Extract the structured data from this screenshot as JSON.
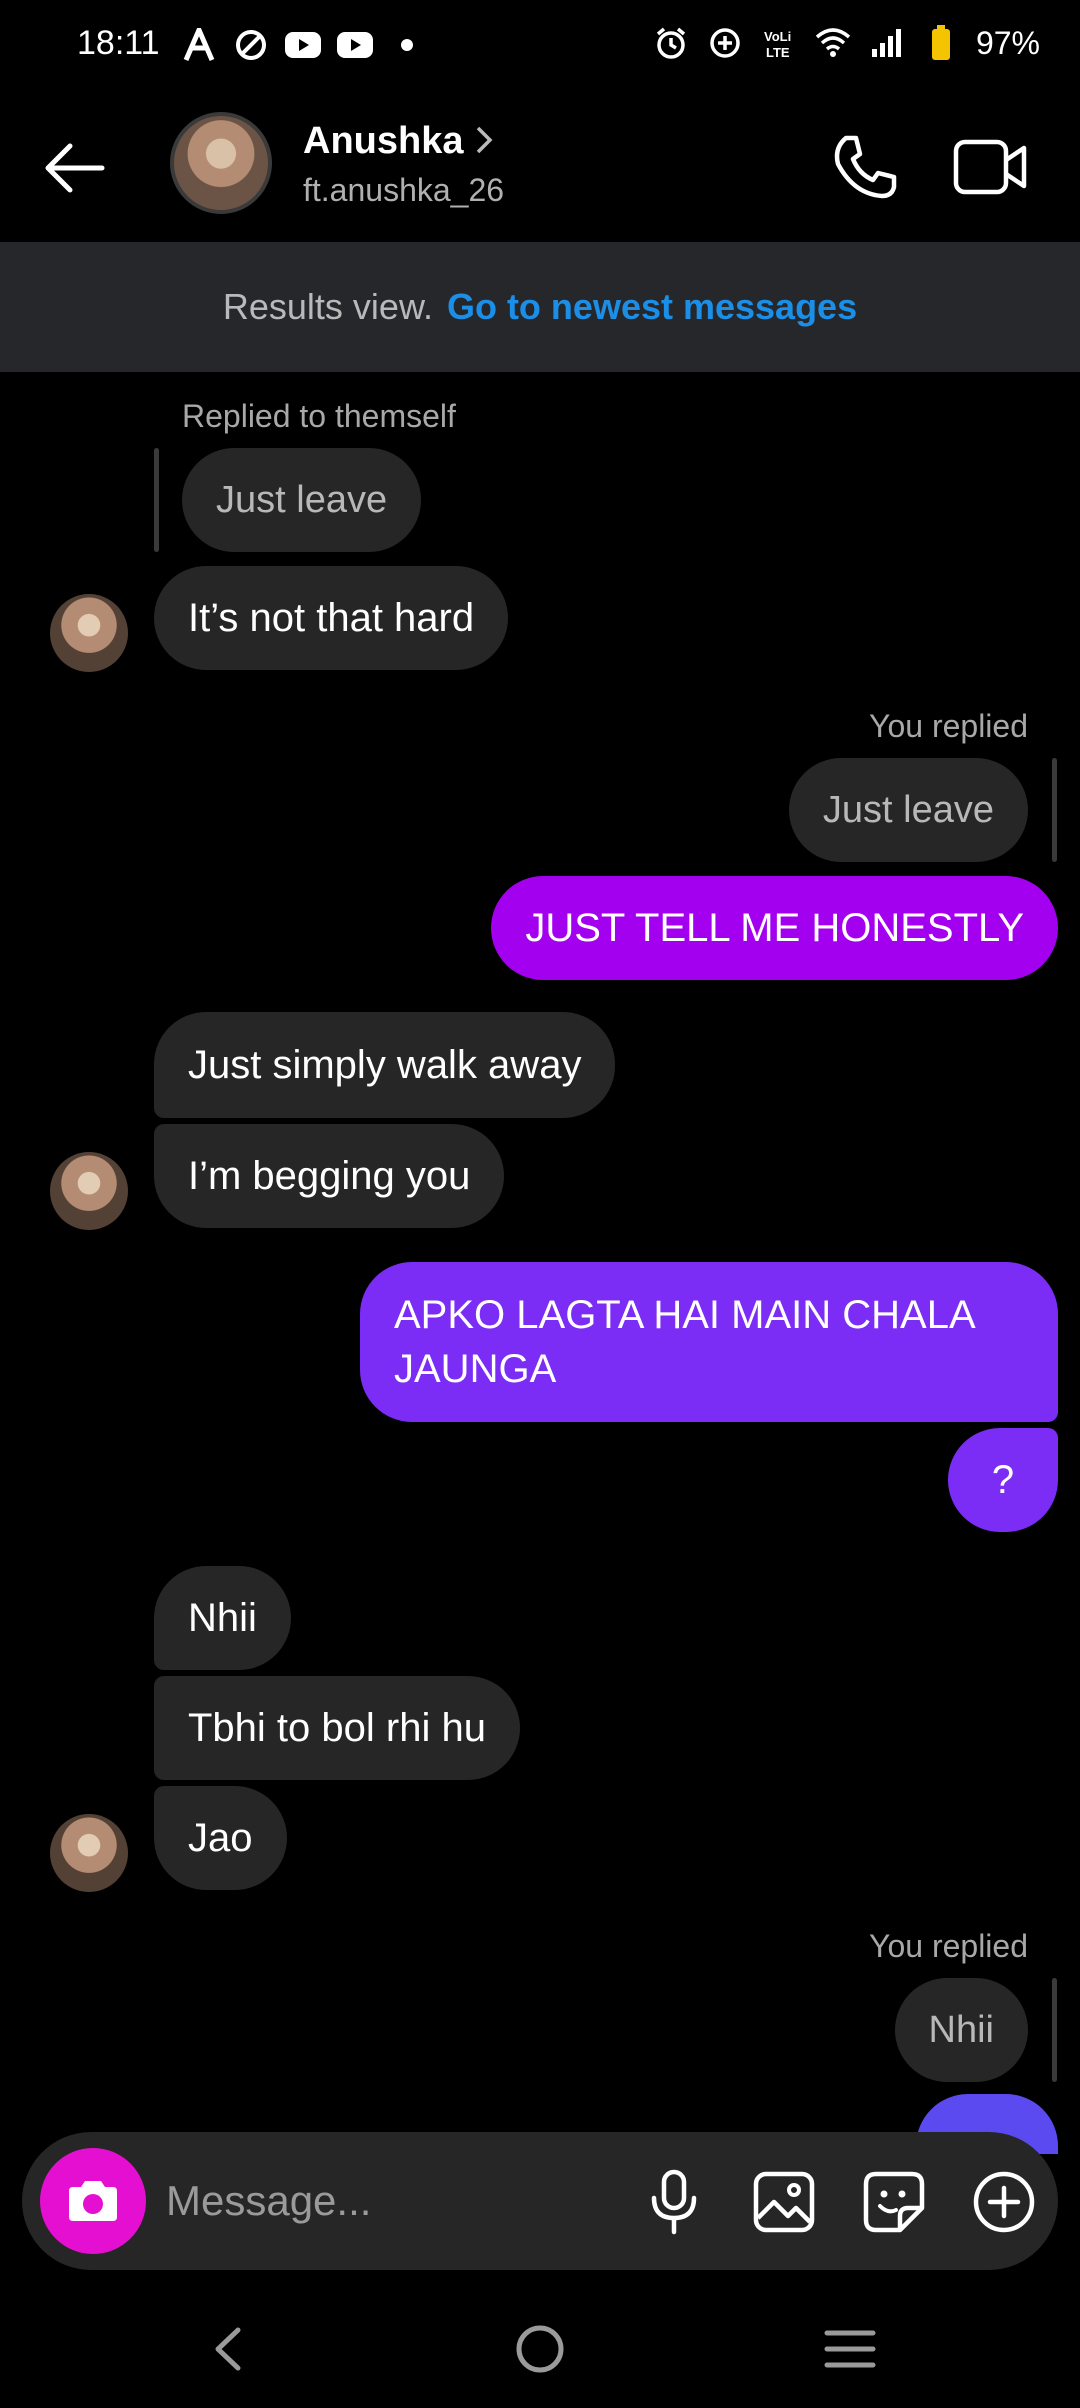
{
  "status_bar": {
    "time": "18:11",
    "battery": "97%",
    "left_icons": [
      "a-icon",
      "slash-icon",
      "youtube-icon",
      "youtube-icon",
      "dot-icon"
    ],
    "right_icons": [
      "alarm-icon",
      "data-saver-icon",
      "volte-icon",
      "wifi-icon",
      "signal-icon",
      "battery-icon"
    ]
  },
  "header": {
    "name": "Anushka",
    "username": "ft.anushka_26"
  },
  "banner": {
    "text": "Results view.",
    "link": "Go to newest messages"
  },
  "messages": {
    "m1_context": "Replied to themself",
    "m1_quote": "Just leave",
    "m2": "It’s not that hard",
    "m3_context": "You replied",
    "m3_quote": "Just leave",
    "m4": "JUST TELL ME HONESTLY",
    "m5": "Just simply walk away",
    "m6": "I’m begging you",
    "m7": "APKO LAGTA HAI MAIN CHALA JAUNGA",
    "m8": "?",
    "m9": "Nhii",
    "m10": "Tbhi to bol rhi hu",
    "m11": "Jao",
    "m12_context": "You replied",
    "m12_quote": "Nhii"
  },
  "composer": {
    "placeholder": "Message..."
  },
  "colors": {
    "accent_blue": "#1b8fe8",
    "bubble_pink": "#a400f0",
    "bubble_purple": "#7b2cf5",
    "camera_magenta": "#e40fd1"
  }
}
